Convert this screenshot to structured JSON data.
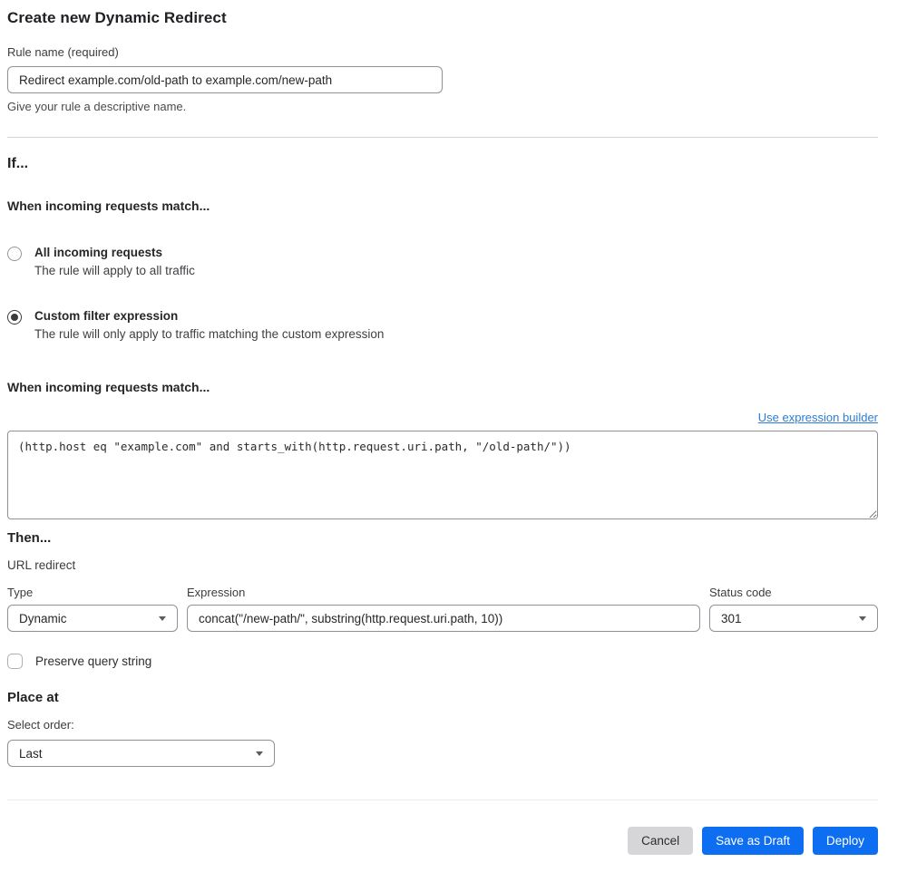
{
  "page": {
    "title": "Create new Dynamic Redirect"
  },
  "rule_name": {
    "label": "Rule name (required)",
    "value": "Redirect example.com/old-path to example.com/new-path",
    "help": "Give your rule a descriptive name."
  },
  "if_section": {
    "heading": "If...",
    "match_heading": "When incoming requests match...",
    "options": [
      {
        "label": "All incoming requests",
        "description": "The rule will apply to all traffic",
        "selected": false
      },
      {
        "label": "Custom filter expression",
        "description": "The rule will only apply to traffic matching the custom expression",
        "selected": true
      }
    ],
    "expression_heading": "When incoming requests match...",
    "builder_link": "Use expression builder",
    "expression_value": "(http.host eq \"example.com\" and starts_with(http.request.uri.path, \"/old-path/\"))"
  },
  "then_section": {
    "heading": "Then...",
    "action_label": "URL redirect",
    "type": {
      "label": "Type",
      "value": "Dynamic"
    },
    "expression": {
      "label": "Expression",
      "value": "concat(\"/new-path/\", substring(http.request.uri.path, 10))"
    },
    "status_code": {
      "label": "Status code",
      "value": "301"
    },
    "preserve_query_label": "Preserve query string",
    "preserve_query_checked": false
  },
  "place_at": {
    "heading": "Place at",
    "label": "Select order:",
    "value": "Last"
  },
  "footer": {
    "cancel_label": "Cancel",
    "save_draft_label": "Save as Draft",
    "deploy_label": "Deploy"
  },
  "colors": {
    "primary_button": "#0d6ef2",
    "secondary_button": "#d6d6d8",
    "link": "#2c7cd6",
    "border": "#8e9196",
    "divider": "#d4d4d9"
  }
}
